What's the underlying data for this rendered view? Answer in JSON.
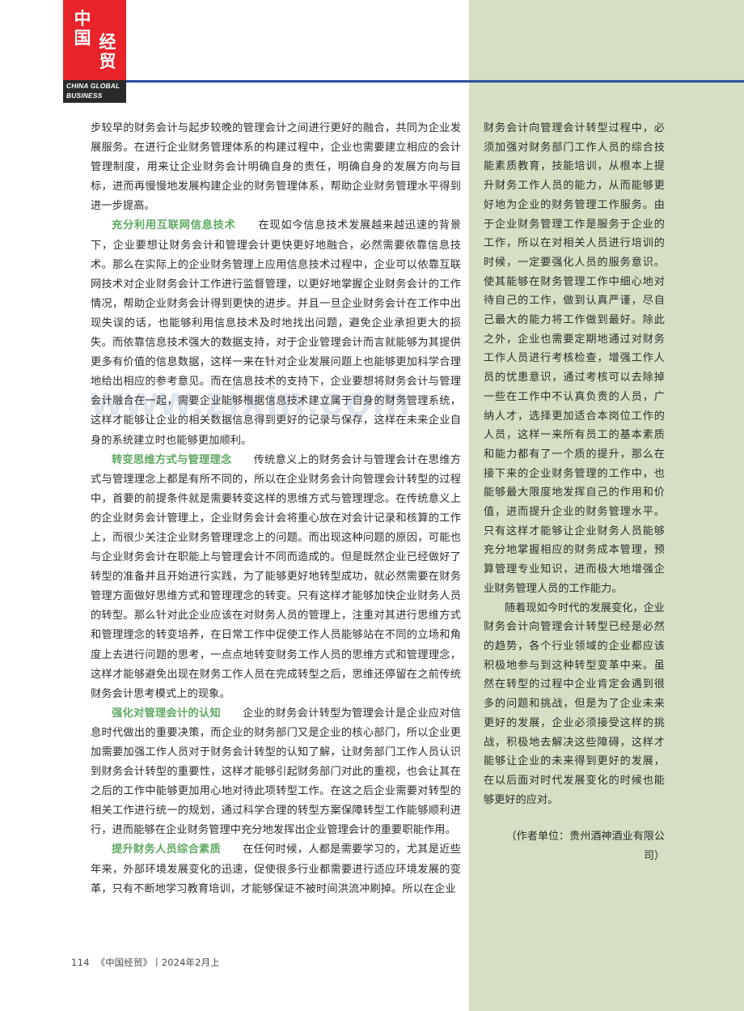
{
  "masthead": {
    "logo_zh_top": "中国",
    "logo_zh_bottom": "经贸",
    "logo_en_line1": "CHINA GLOBAL",
    "logo_en_line2": "BUSINESS",
    "rule_color": "#2f4f9e",
    "logo_red": "#e8232a",
    "logo_dark": "#2b2b2b"
  },
  "theme": {
    "panel_green": "#d4dfc3",
    "subhead_green": "#5fa862",
    "body_text": "#2d2d2d"
  },
  "watermark": {
    "text": "www.zixin.com"
  },
  "left_column": {
    "paragraphs": [
      {
        "id": "p1",
        "indent": false,
        "heading": "",
        "text": "步较早的财务会计与起步较晚的管理会计之间进行更好的融合，共同为企业发展服务。在进行企业财务管理体系的构建过程中，企业也需要建立相应的会计管理制度，用来让企业财务会计明确自身的责任，明确自身的发展方向与目标，进而再慢慢地发展构建企业的财务管理体系，帮助企业财务管理水平得到进一步提高。"
      },
      {
        "id": "p2",
        "indent": true,
        "heading": "充分利用互联网信息技术",
        "text": "在现如今信息技术发展越来越迅速的背景下，企业要想让财务会计和管理会计更快更好地融合，必然需要依靠信息技术。那么在实际上的企业财务管理上应用信息技术过程中，企业可以依靠互联网技术对企业财务会计工作进行监督管理，以更好地掌握企业财务会计的工作情况，帮助企业财务会计得到更快的进步。并且一旦企业财务会计在工作中出现失误的话，也能够利用信息技术及时地找出问题，避免企业承担更大的损失。而依靠信息技术强大的数据支持，对于企业管理会计而言就能够为其提供更多有价值的信息数据，这样一来在针对企业发展问题上也能够更加科学合理地给出相应的参考意见。而在信息技术的支持下，企业要想将财务会计与管理会计融合在一起，需要企业能够根据信息技术建立属于自身的财务管理系统，这样才能够让企业的相关数据信息得到更好的记录与保存，这样在未来企业自身的系统建立时也能够更加顺利。"
      },
      {
        "id": "p3",
        "indent": true,
        "heading": "转变思维方式与管理理念",
        "text": "传统意义上的财务会计与管理会计在思维方式与管理理念上都是有所不同的，所以在企业财务会计向管理会计转型的过程中，首要的前提条件就是需要转变这样的思维方式与管理理念。在传统意义上的企业财务会计管理上，企业财务会计会将重心放在对会计记录和核算的工作上，而很少关注企业财务管理理念上的问题。而出现这种问题的原因，可能也与企业财务会计在职能上与管理会计不同而造成的。但是既然企业已经做好了转型的准备并且开始进行实践，为了能够更好地转型成功，就必然需要在财务管理方面做好思维方式和管理理念的转变。只有这样才能够加快企业财务人员的转型。那么针对此企业应该在对财务人员的管理上，注重对其进行思维方式和管理理念的转变培养，在日常工作中促使工作人员能够站在不同的立场和角度上去进行问题的思考，一点点地转变财务工作人员的思维方式和管理理念，这样才能够避免出现在财务工作人员在完成转型之后，思维还停留在之前传统财务会计思考模式上的现象。"
      },
      {
        "id": "p4",
        "indent": true,
        "heading": "强化对管理会计的认知",
        "text": "企业的财务会计转型为管理会计是企业应对信息时代做出的重要决策，而企业的财务部门又是企业的核心部门，所以企业更加需要加强工作人员对于财务会计转型的认知了解，让财务部门工作人员认识到财务会计转型的重要性，这样才能够引起财务部门对此的重视，也会让其在之后的工作中能够更加用心地对待此项转型工作。在这之后企业需要对转型的相关工作进行统一的规划，通过科学合理的转型方案保障转型工作能够顺利进行，进而能够在企业财务管理中充分地发挥出企业管理会计的重要职能作用。"
      },
      {
        "id": "p5",
        "indent": true,
        "heading": "提升财务人员综合素质",
        "text": "在任何时候，人都是需要学习的，尤其是近些年来，外部环境发展变化的迅速，促使很多行业都需要进行适应环境发展的变革，只有不断地学习教育培训，才能够保证不被时间洪流冲刷掉。所以在企业"
      }
    ]
  },
  "right_column": {
    "paragraphs": [
      {
        "id": "r1",
        "indent": false,
        "text": "财务会计向管理会计转型过程中，必须加强对财务部门工作人员的综合技能素质教育，技能培训，从根本上提升财务工作人员的能力，从而能够更好地为企业的财务管理工作服务。由于企业财务管理工作是服务于企业的工作，所以在对相关人员进行培训的时候，一定要强化人员的服务意识。使其能够在财务管理工作中细心地对待自己的工作，做到认真严谨，尽自己最大的能力将工作做到最好。除此之外，企业也需要定期地通过对财务工作人员进行考核检查，增强工作人员的忧患意识，通过考核可以去除掉一些在工作中不认真负责的人员，广纳人才，选择更加适合本岗位工作的人员，这样一来所有员工的基本素质和能力都有了一个质的提升，那么在接下来的企业财务管理的工作中，也能够最大限度地发挥自己的作用和价值，进而提升企业的财务管理水平。只有这样才能够让企业财务人员能够充分地掌握相应的财务成本管理，预算管理专业知识，进而极大地增强企业财务管理人员的工作能力。"
      },
      {
        "id": "r2",
        "indent": true,
        "text": "随着现如今时代的发展变化，企业财务会计向管理会计转型已经是必然的趋势，各个行业领域的企业都应该积极地参与到这种转型变革中来。虽然在转型的过程中企业肯定会遇到很多的问题和挑战，但是为了企业未来更好的发展，企业必须接受这样的挑战，积极地去解决这些障碍，这样才能够让企业的未来得到更好的发展，在以后面对时代发展变化的时候也能够更好的应对。"
      }
    ],
    "author_note": "（作者单位：贵州酒神酒业有限公司）"
  },
  "footer": {
    "page_number": "114",
    "journal": "《中国经贸》",
    "separator": "丨",
    "issue": "2024年2月上"
  }
}
